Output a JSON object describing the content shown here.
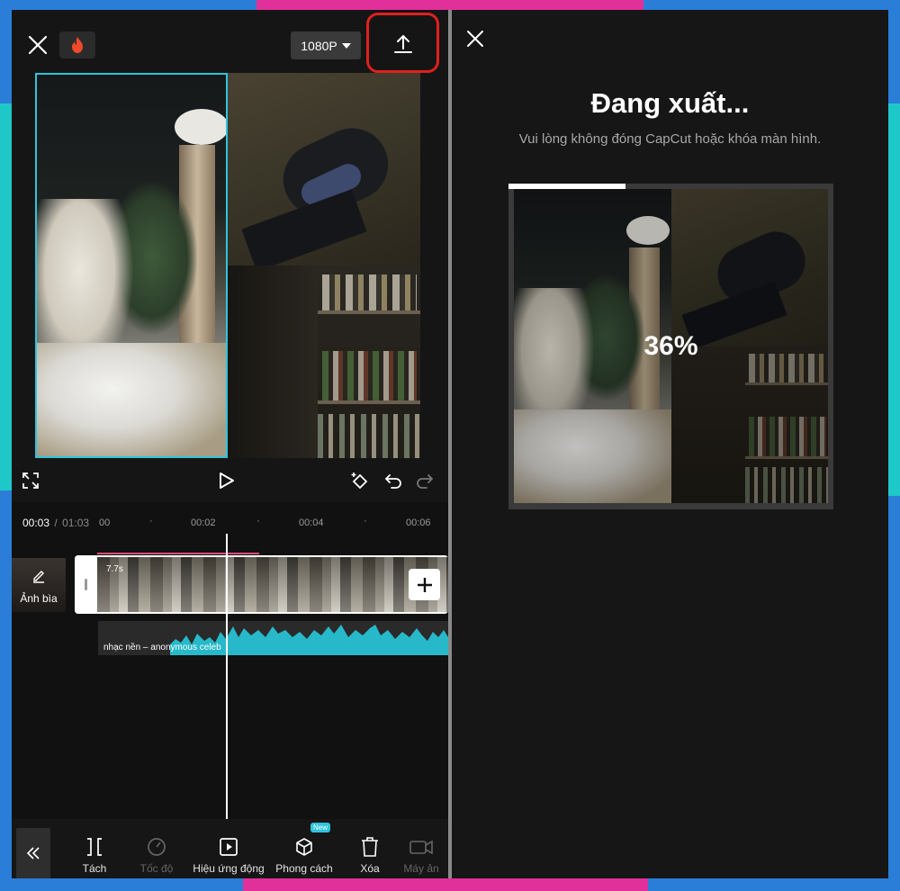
{
  "colors": {
    "frame_blue": "#2a7ed8",
    "frame_pink": "#e2309a",
    "frame_teal": "#1fc8c8",
    "accent_cyan": "#2fc4dc",
    "highlight_red": "#e0201e",
    "playhead_marker": "#e84a7a",
    "audio_wave": "#27b8c9"
  },
  "editor": {
    "resolution_label": "1080P",
    "time_current": "00:03",
    "time_separator": "/",
    "time_total": "01:03",
    "ruler_ticks": [
      "00",
      "00:02",
      "00:04",
      "00:06"
    ],
    "cover_label": "Ảnh bìa",
    "clip_duration": "7.7s",
    "audio_label": "nhạc nền – anonymous celeb",
    "toolbar": [
      {
        "label": "Tách",
        "icon": "split-icon",
        "enabled": true
      },
      {
        "label": "Tốc độ",
        "icon": "speed-icon",
        "enabled": false
      },
      {
        "label": "Hiệu ứng động",
        "icon": "animation-icon",
        "enabled": true
      },
      {
        "label": "Phong cách",
        "icon": "style-icon",
        "enabled": true,
        "badge": "New"
      },
      {
        "label": "Xóa",
        "icon": "delete-icon",
        "enabled": true
      },
      {
        "label": "Máy ản",
        "icon": "camera-icon",
        "enabled": false
      }
    ]
  },
  "export": {
    "title": "Đang xuất...",
    "subtitle": "Vui lòng không đóng CapCut hoặc khóa màn hình.",
    "progress_percent": "36%",
    "progress_fraction": 0.36
  }
}
